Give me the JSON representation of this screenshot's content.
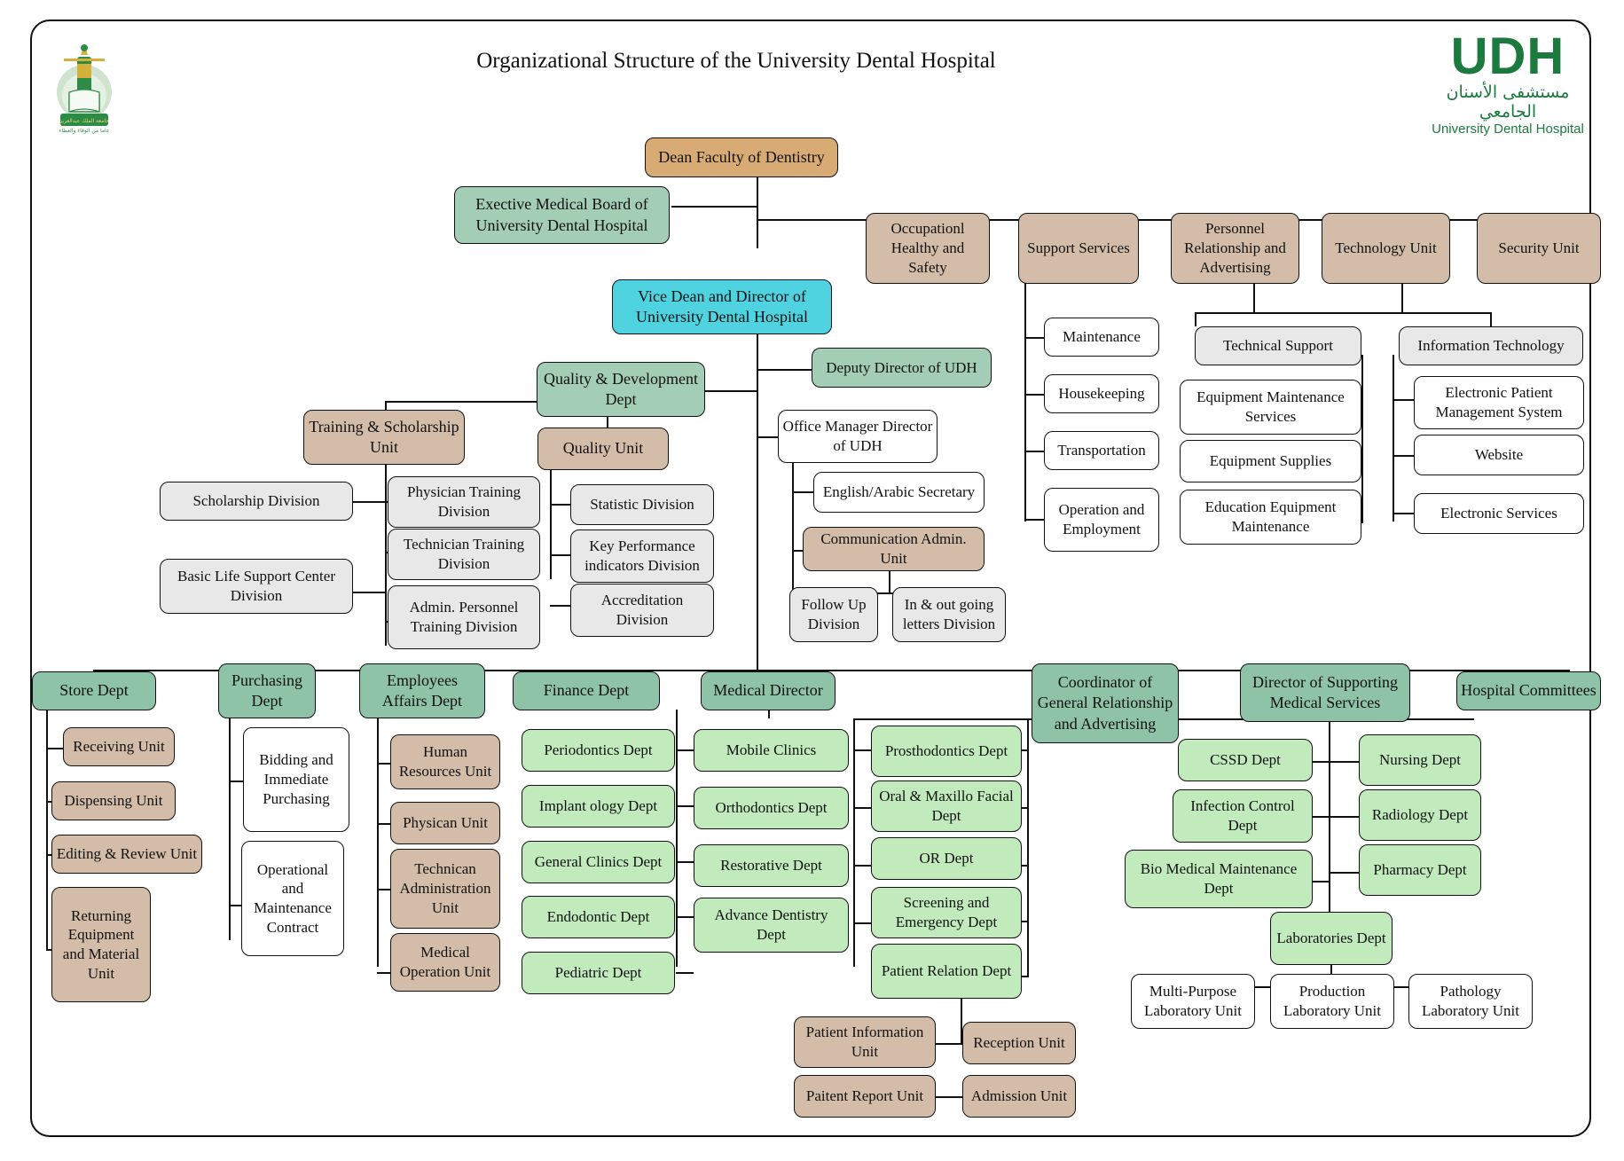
{
  "title": "Organizational Structure of the University Dental Hospital",
  "logos": {
    "left_name": "king-abdulaziz-university-logo",
    "right": {
      "acronym": "UDH",
      "arabic": "مستشفى الأسنان الجامعي",
      "english": "University Dental Hospital"
    }
  },
  "colors": {
    "dean": "#d8ab74",
    "board": "#a3cdb4",
    "vice_dean": "#4fd3e0",
    "beige": "#d3bda8",
    "gray": "#e8e8e8",
    "white": "#ffffff",
    "dept_green": "#8fc3a7",
    "clinical_green": "#c2ebbd",
    "brand_green": "#1c7a3e"
  },
  "nodes": {
    "dean": "Dean Faculty of Dentistry",
    "board": "Exective Medical Board of University Dental Hospital",
    "vice_dean": "Vice Dean and Director of University Dental Hospital",
    "deputy_director": "Deputy Director of UDH",
    "occupational": "Occupationl Healthy and Safety",
    "support_services": "Support Services",
    "personnel_relationship": "Personnel Relationship and Advertising",
    "technology_unit": "Technology Unit",
    "security_unit": "Security Unit",
    "maintenance": "Maintenance",
    "housekeeping": "Housekeeping",
    "transportation": "Transportation",
    "operation_employment": "Operation and Employment",
    "technical_support": "Technical Support",
    "equipment_maintenance_services": "Equipment Maintenance Services",
    "equipment_supplies": "Equipment Supplies",
    "education_equipment_maintenance": "Education Equipment Maintenance",
    "information_technology": "Information Technology",
    "electronic_patient_mgmt": "Electronic Patient Management System",
    "website": "Website",
    "electronic_services": "Electronic Services",
    "quality_development": "Quality & Development Dept",
    "training_scholarship": "Training & Scholarship Unit",
    "quality_unit": "Quality Unit",
    "scholarship_division": "Scholarship Division",
    "basic_life_support": "Basic Life Support Center Division",
    "physician_training": "Physician Training Division",
    "technician_training": "Technician Training Division",
    "admin_personnel_training": "Admin. Personnel Training Division",
    "statistic_division": "Statistic Division",
    "kpi_division": "Key Performance indicators Division",
    "accreditation_division": "Accreditation Division",
    "office_manager": "Office Manager Director of UDH",
    "english_arabic_secretary": "English/Arabic Secretary",
    "communication_admin": "Communication Admin. Unit",
    "follow_up_division": "Follow Up Division",
    "in_out_letters": "In & out going letters Division",
    "store_dept": "Store Dept",
    "receiving_unit": "Receiving Unit",
    "dispensing_unit": "Dispensing Unit",
    "editing_review_unit": "Editing & Review Unit",
    "returning_equipment": "Returning Equipment and Material Unit",
    "purchasing_dept": "Purchasing Dept",
    "bidding_immediate": "Bidding and Immediate Purchasing",
    "operational_maintenance": "Operational and Maintenance Contract",
    "employees_affairs": "Employees Affairs Dept",
    "human_resources_unit": "Human Resources Unit",
    "physican_unit": "Physican Unit",
    "technican_admin_unit": "Technican Administration Unit",
    "medical_operation_unit": "Medical Operation Unit",
    "finance_dept": "Finance Dept",
    "periodontics": "Periodontics Dept",
    "implantology": "Implant ology Dept",
    "general_clinics": "General Clinics Dept",
    "endodontic": "Endodontic Dept",
    "pediatric": "Pediatric Dept",
    "medical_director": "Medical Director",
    "mobile_clinics": "Mobile Clinics",
    "orthodontics": "Orthodontics Dept",
    "restorative": "Restorative Dept",
    "advance_dentistry": "Advance Dentistry Dept",
    "prosthodontics": "Prosthodontics Dept",
    "oral_maxillo": "Oral & Maxillo Facial Dept",
    "or_dept": "OR Dept",
    "screening_emergency": "Screening and Emergency Dept",
    "patient_relation": "Patient Relation Dept",
    "patient_information_unit": "Patient Information Unit",
    "paitent_report_unit": "Paitent Report Unit",
    "reception_unit": "Reception Unit",
    "admission_unit": "Admission Unit",
    "coordinator_general": "Coordinator of General Relationship and Advertising",
    "director_supporting": "Director of Supporting Medical Services",
    "cssd_dept": "CSSD Dept",
    "infection_control": "Infection Control Dept",
    "bio_medical_maintenance": "Bio Medical Maintenance Dept",
    "nursing_dept": "Nursing Dept",
    "radiology_dept": "Radiology Dept",
    "pharmacy_dept": "Pharmacy Dept",
    "laboratories_dept": "Laboratories Dept",
    "multi_purpose_lab": "Multi-Purpose Laboratory Unit",
    "production_lab": "Production Laboratory Unit",
    "pathology_lab": "Pathology Laboratory Unit",
    "hospital_committees": "Hospital Committees"
  }
}
